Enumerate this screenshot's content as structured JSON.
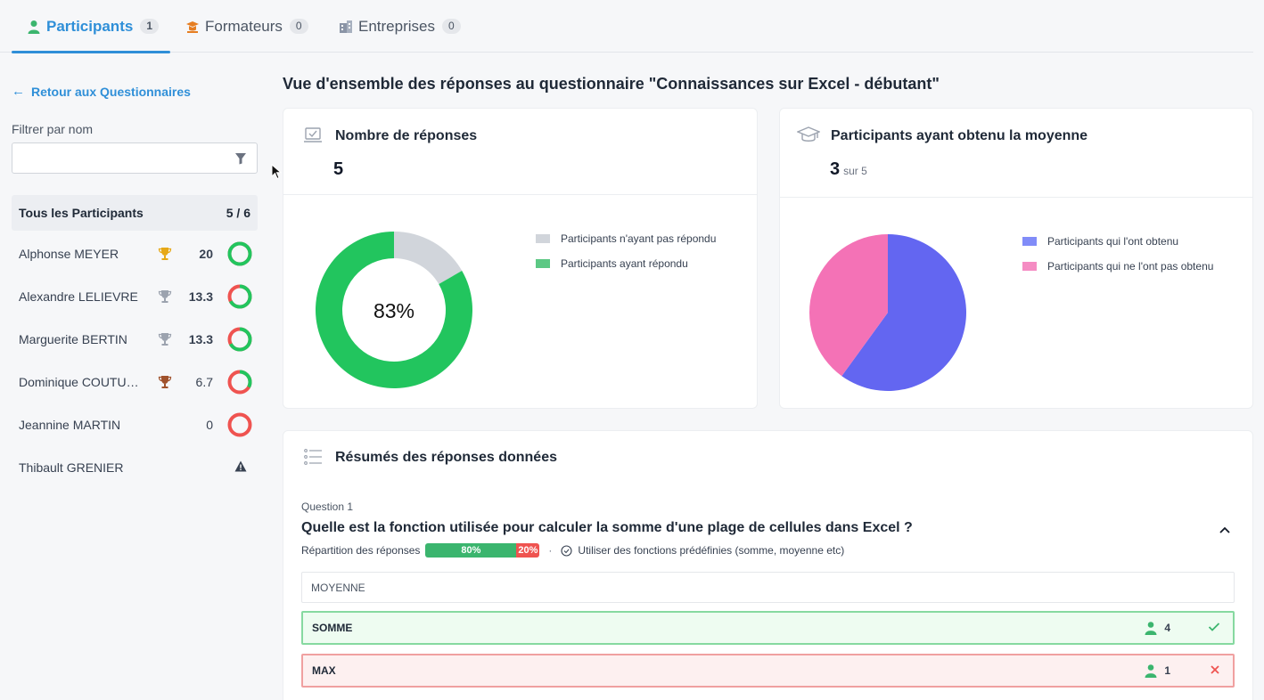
{
  "tabs": [
    {
      "label": "Participants",
      "count": "1"
    },
    {
      "label": "Formateurs",
      "count": "0"
    },
    {
      "label": "Entreprises",
      "count": "0"
    }
  ],
  "sidebar": {
    "back_label": "Retour aux Questionnaires",
    "filter_label": "Filtrer par nom",
    "filter_value": "",
    "all_label": "Tous les Participants",
    "all_count": "5 / 6",
    "participants": [
      {
        "name": "Alphonse MEYER",
        "score": "20",
        "trophy": "gold",
        "progress": 1.0
      },
      {
        "name": "Alexandre LELIEVRE",
        "score": "13.3",
        "trophy": "silver",
        "progress": 0.67
      },
      {
        "name": "Marguerite BERTIN",
        "score": "13.3",
        "trophy": "silver",
        "progress": 0.67
      },
      {
        "name": "Dominique COUTU…",
        "score": "6.7",
        "trophy": "bronze",
        "progress": 0.33
      },
      {
        "name": "Jeannine MARTIN",
        "score": "0",
        "trophy": "none",
        "progress": 0.0
      },
      {
        "name": "Thibault GRENIER",
        "score": "",
        "trophy": "none",
        "progress": null,
        "warning": true
      }
    ]
  },
  "main": {
    "title": "Vue d'ensemble des réponses au questionnaire \"Connaissances sur Excel - débutant\"",
    "responses_card": {
      "title": "Nombre de réponses",
      "value": "5",
      "center_label": "83%",
      "legend": [
        "Participants n'ayant pas répondu",
        "Participants ayant répondu"
      ]
    },
    "average_card": {
      "title": "Participants ayant obtenu la moyenne",
      "value": "3",
      "sub": "sur 5",
      "legend": [
        "Participants qui l'ont obtenu",
        "Participants qui ne l'ont pas obtenu"
      ]
    },
    "summary": {
      "title": "Résumés des réponses données",
      "question_label": "Question 1",
      "question_text": "Quelle est la fonction utilisée pour calculer la somme d'une plage de cellules dans Excel ?",
      "repartition_label": "Répartition des réponses",
      "good_pct": "80%",
      "bad_pct": "20%",
      "skill": "Utiliser des fonctions prédéfinies (somme, moyenne etc)",
      "answers": [
        {
          "label": "MOYENNE",
          "state": "neutral",
          "count": ""
        },
        {
          "label": "SOMME",
          "state": "correct",
          "count": "4"
        },
        {
          "label": "MAX",
          "state": "wrong",
          "count": "1"
        }
      ]
    }
  },
  "chart_data": [
    {
      "type": "pie",
      "variant": "donut",
      "categories": [
        "Participants n'ayant pas répondu",
        "Participants ayant répondu"
      ],
      "values": [
        1,
        5
      ],
      "colors": [
        "#d1d5db",
        "#22c55e"
      ],
      "center_label": "83%",
      "legend": "top-right"
    },
    {
      "type": "pie",
      "categories": [
        "Participants qui l'ont obtenu",
        "Participants qui ne l'ont pas obtenu"
      ],
      "values": [
        3,
        2
      ],
      "colors": [
        "#6366f1",
        "#f472b6"
      ],
      "legend": "top-right"
    }
  ],
  "colors": {
    "accent": "#2f8fd8",
    "good": "#22c55e",
    "bad": "#ef5350"
  }
}
